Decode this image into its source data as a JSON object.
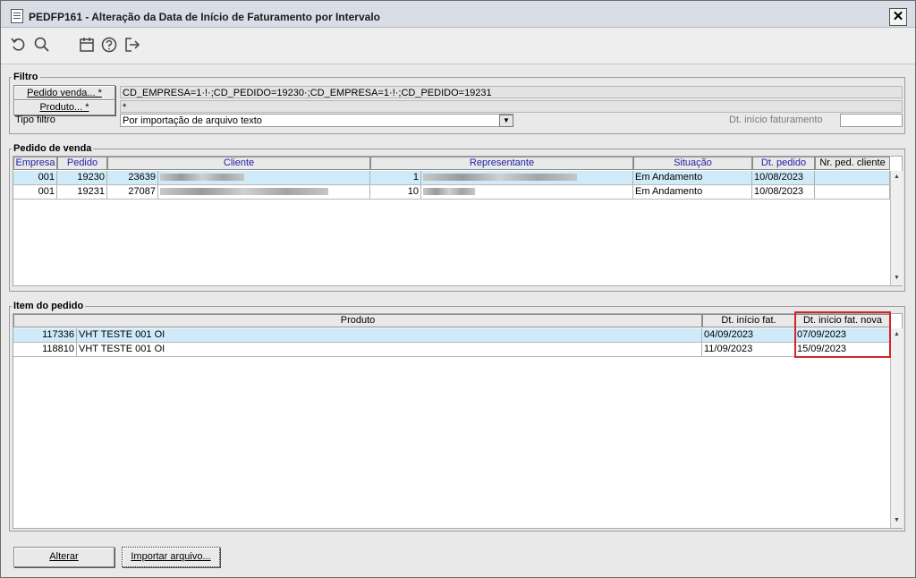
{
  "window": {
    "title": "PEDFP161 - Alteração da Data de Início de Faturamento por Intervalo",
    "close_label": "✕"
  },
  "toolbar": {
    "icons": [
      "undo-icon",
      "search-icon",
      "calendar-icon",
      "help-icon",
      "exit-icon"
    ]
  },
  "filtro": {
    "legend": "Filtro",
    "pedido_btn": "Pedido venda... *",
    "pedido_value": "CD_EMPRESA=1·!·;CD_PEDIDO=19230·;CD_EMPRESA=1·!·;CD_PEDIDO=19231",
    "produto_btn": "Produto... *",
    "produto_value": "*",
    "tipo_label": "Tipo filtro",
    "tipo_value": "Por importação de arquivo texto",
    "dt_inicio_label": "Dt. início faturamento",
    "dt_inicio_value": ""
  },
  "pedido_venda": {
    "legend": "Pedido de venda",
    "columns": [
      "Empresa",
      "Pedido",
      "Cliente",
      "Representante",
      "Situação",
      "Dt. pedido",
      "Nr. ped. cliente"
    ],
    "rows": [
      {
        "empresa": "001",
        "pedido": "19230",
        "cliente_cod": "23639",
        "rep_cod": "1",
        "situacao": "Em Andamento",
        "dt_pedido": "10/08/2023",
        "nr_ped": ""
      },
      {
        "empresa": "001",
        "pedido": "19231",
        "cliente_cod": "27087",
        "rep_cod": "10",
        "situacao": "Em Andamento",
        "dt_pedido": "10/08/2023",
        "nr_ped": ""
      }
    ]
  },
  "item_pedido": {
    "legend": "Item do pedido",
    "columns": [
      "Produto",
      "Dt. início fat.",
      "Dt. início fat. nova"
    ],
    "rows": [
      {
        "cod": "117336",
        "produto": "VHT TESTE 001 OI",
        "dt_inicio": "04/09/2023",
        "dt_nova": "07/09/2023"
      },
      {
        "cod": "118810",
        "produto": "VHT TESTE 001 OI",
        "dt_inicio": "11/09/2023",
        "dt_nova": "15/09/2023"
      }
    ]
  },
  "footer": {
    "alterar_btn": "Alterar",
    "importar_btn": "Importar arquivo..."
  },
  "colors": {
    "selected_row": "#cfeaf8",
    "header_blue": "#2020a8",
    "highlight": "#d0262a"
  }
}
